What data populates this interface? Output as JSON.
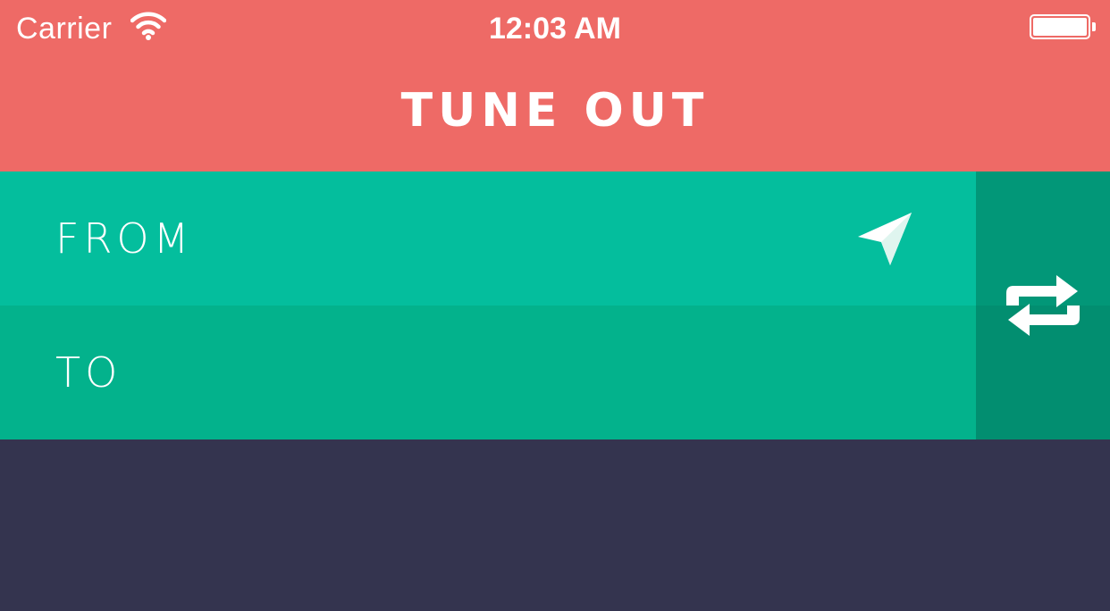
{
  "status_bar": {
    "carrier": "Carrier",
    "time": "12:03 AM",
    "wifi_icon": "wifi-icon",
    "battery_icon": "battery-icon",
    "battery_level": 1.0
  },
  "header": {
    "title": "TUNE OUT",
    "color": "#ee6a66"
  },
  "route": {
    "from_label": "FROM",
    "to_label": "TO",
    "locate_icon": "location-arrow-icon",
    "swap_icon": "swap-arrows-icon",
    "from_color": "#04be9d",
    "to_color": "#03b28c",
    "swap_color": "#029778"
  },
  "content": {
    "background": "#34344f"
  }
}
